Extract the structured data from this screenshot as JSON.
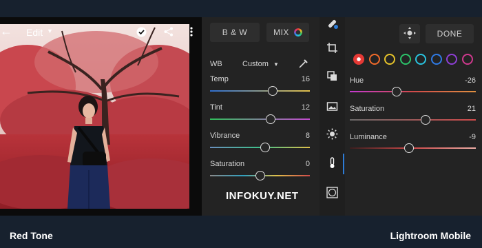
{
  "editor": {
    "back_icon": "arrow-left-icon",
    "title": "Edit",
    "confirm_icon": "check-circle-icon",
    "share_icon": "share-icon",
    "more_icon": "more-vertical-icon"
  },
  "panel_left": {
    "bw_label": "B & W",
    "mix_label": "MIX",
    "wb_label": "WB",
    "wb_value": "Custom",
    "eyedropper_icon": "eyedropper-icon",
    "sliders": [
      {
        "label": "Temp",
        "value": "16",
        "level": 0.63
      },
      {
        "label": "Tint",
        "value": "12",
        "level": 0.61
      },
      {
        "label": "Vibrance",
        "value": "8",
        "level": 0.55
      },
      {
        "label": "Saturation",
        "value": "0",
        "level": 0.5
      }
    ]
  },
  "toolstrip": {
    "icons": [
      "healing-icon",
      "crop-icon",
      "layers-icon",
      "image-adjust-icon",
      "light-icon",
      "temperature-icon",
      "vignette-icon"
    ],
    "active_index": 5
  },
  "panel_right": {
    "target_icon": "target-adjust-icon",
    "done_label": "DONE",
    "color_dots": [
      "#e53935",
      "#f26b2a",
      "#e6c32a",
      "#2cc46a",
      "#29c4e0",
      "#2f7be6",
      "#8e3fd6",
      "#d0398e"
    ],
    "selected_color_index": 0,
    "sliders": [
      {
        "label": "Hue",
        "value": "-26",
        "level": 0.37
      },
      {
        "label": "Saturation",
        "value": "21",
        "level": 0.6
      },
      {
        "label": "Luminance",
        "value": "-9",
        "level": 0.47
      }
    ]
  },
  "watermark": "INFOKUY.NET",
  "captions": {
    "left": "Red Tone",
    "right": "Lightroom Mobile"
  },
  "colors": {
    "background": "#17212e",
    "panel": "#232323",
    "accent": "#2e7cd6"
  }
}
